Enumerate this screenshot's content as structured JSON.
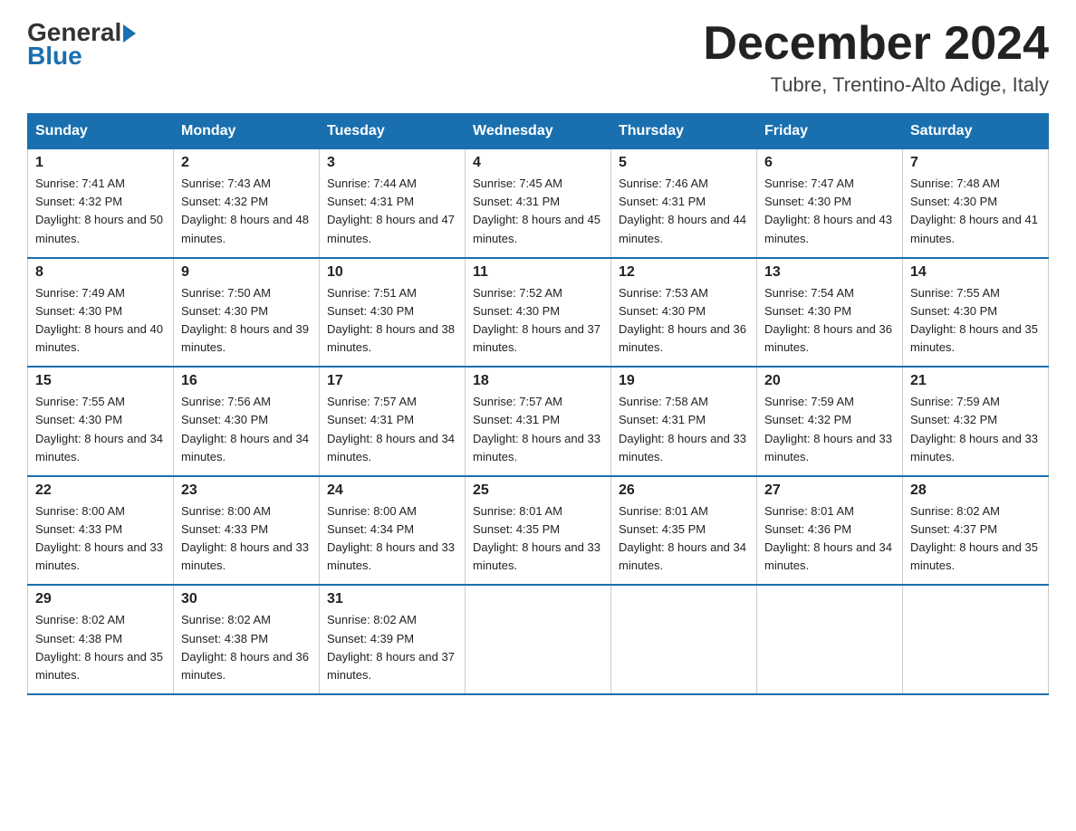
{
  "header": {
    "logo_general": "General",
    "logo_blue": "Blue",
    "title": "December 2024",
    "subtitle": "Tubre, Trentino-Alto Adige, Italy"
  },
  "days_of_week": [
    "Sunday",
    "Monday",
    "Tuesday",
    "Wednesday",
    "Thursday",
    "Friday",
    "Saturday"
  ],
  "weeks": [
    [
      {
        "day": "1",
        "sunrise": "7:41 AM",
        "sunset": "4:32 PM",
        "daylight": "8 hours and 50 minutes."
      },
      {
        "day": "2",
        "sunrise": "7:43 AM",
        "sunset": "4:32 PM",
        "daylight": "8 hours and 48 minutes."
      },
      {
        "day": "3",
        "sunrise": "7:44 AM",
        "sunset": "4:31 PM",
        "daylight": "8 hours and 47 minutes."
      },
      {
        "day": "4",
        "sunrise": "7:45 AM",
        "sunset": "4:31 PM",
        "daylight": "8 hours and 45 minutes."
      },
      {
        "day": "5",
        "sunrise": "7:46 AM",
        "sunset": "4:31 PM",
        "daylight": "8 hours and 44 minutes."
      },
      {
        "day": "6",
        "sunrise": "7:47 AM",
        "sunset": "4:30 PM",
        "daylight": "8 hours and 43 minutes."
      },
      {
        "day": "7",
        "sunrise": "7:48 AM",
        "sunset": "4:30 PM",
        "daylight": "8 hours and 41 minutes."
      }
    ],
    [
      {
        "day": "8",
        "sunrise": "7:49 AM",
        "sunset": "4:30 PM",
        "daylight": "8 hours and 40 minutes."
      },
      {
        "day": "9",
        "sunrise": "7:50 AM",
        "sunset": "4:30 PM",
        "daylight": "8 hours and 39 minutes."
      },
      {
        "day": "10",
        "sunrise": "7:51 AM",
        "sunset": "4:30 PM",
        "daylight": "8 hours and 38 minutes."
      },
      {
        "day": "11",
        "sunrise": "7:52 AM",
        "sunset": "4:30 PM",
        "daylight": "8 hours and 37 minutes."
      },
      {
        "day": "12",
        "sunrise": "7:53 AM",
        "sunset": "4:30 PM",
        "daylight": "8 hours and 36 minutes."
      },
      {
        "day": "13",
        "sunrise": "7:54 AM",
        "sunset": "4:30 PM",
        "daylight": "8 hours and 36 minutes."
      },
      {
        "day": "14",
        "sunrise": "7:55 AM",
        "sunset": "4:30 PM",
        "daylight": "8 hours and 35 minutes."
      }
    ],
    [
      {
        "day": "15",
        "sunrise": "7:55 AM",
        "sunset": "4:30 PM",
        "daylight": "8 hours and 34 minutes."
      },
      {
        "day": "16",
        "sunrise": "7:56 AM",
        "sunset": "4:30 PM",
        "daylight": "8 hours and 34 minutes."
      },
      {
        "day": "17",
        "sunrise": "7:57 AM",
        "sunset": "4:31 PM",
        "daylight": "8 hours and 34 minutes."
      },
      {
        "day": "18",
        "sunrise": "7:57 AM",
        "sunset": "4:31 PM",
        "daylight": "8 hours and 33 minutes."
      },
      {
        "day": "19",
        "sunrise": "7:58 AM",
        "sunset": "4:31 PM",
        "daylight": "8 hours and 33 minutes."
      },
      {
        "day": "20",
        "sunrise": "7:59 AM",
        "sunset": "4:32 PM",
        "daylight": "8 hours and 33 minutes."
      },
      {
        "day": "21",
        "sunrise": "7:59 AM",
        "sunset": "4:32 PM",
        "daylight": "8 hours and 33 minutes."
      }
    ],
    [
      {
        "day": "22",
        "sunrise": "8:00 AM",
        "sunset": "4:33 PM",
        "daylight": "8 hours and 33 minutes."
      },
      {
        "day": "23",
        "sunrise": "8:00 AM",
        "sunset": "4:33 PM",
        "daylight": "8 hours and 33 minutes."
      },
      {
        "day": "24",
        "sunrise": "8:00 AM",
        "sunset": "4:34 PM",
        "daylight": "8 hours and 33 minutes."
      },
      {
        "day": "25",
        "sunrise": "8:01 AM",
        "sunset": "4:35 PM",
        "daylight": "8 hours and 33 minutes."
      },
      {
        "day": "26",
        "sunrise": "8:01 AM",
        "sunset": "4:35 PM",
        "daylight": "8 hours and 34 minutes."
      },
      {
        "day": "27",
        "sunrise": "8:01 AM",
        "sunset": "4:36 PM",
        "daylight": "8 hours and 34 minutes."
      },
      {
        "day": "28",
        "sunrise": "8:02 AM",
        "sunset": "4:37 PM",
        "daylight": "8 hours and 35 minutes."
      }
    ],
    [
      {
        "day": "29",
        "sunrise": "8:02 AM",
        "sunset": "4:38 PM",
        "daylight": "8 hours and 35 minutes."
      },
      {
        "day": "30",
        "sunrise": "8:02 AM",
        "sunset": "4:38 PM",
        "daylight": "8 hours and 36 minutes."
      },
      {
        "day": "31",
        "sunrise": "8:02 AM",
        "sunset": "4:39 PM",
        "daylight": "8 hours and 37 minutes."
      },
      null,
      null,
      null,
      null
    ]
  ],
  "colors": {
    "header_bg": "#1a6faf",
    "header_text": "#ffffff",
    "border": "#cccccc",
    "text": "#222222",
    "logo_blue": "#1a6faf"
  }
}
